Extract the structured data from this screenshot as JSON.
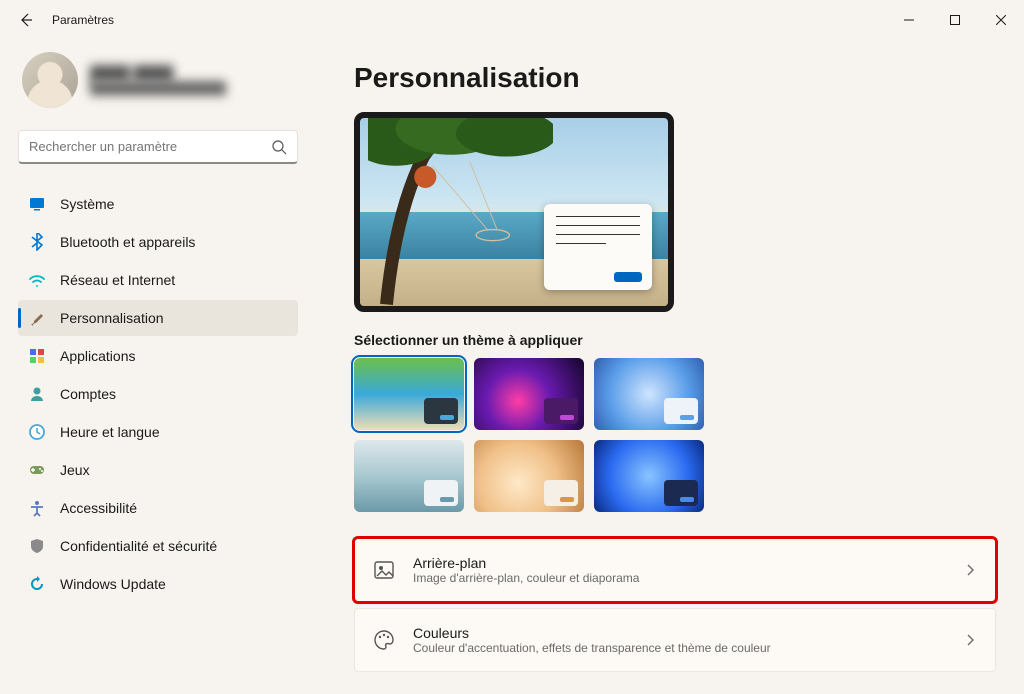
{
  "window": {
    "title": "Paramètres"
  },
  "profile": {
    "name": "████ ████",
    "email": "████████████████"
  },
  "search": {
    "placeholder": "Rechercher un paramètre"
  },
  "nav": {
    "items": [
      {
        "label": "Système",
        "icon": "system",
        "color": "#0078d4"
      },
      {
        "label": "Bluetooth et appareils",
        "icon": "bluetooth",
        "color": "#0078d4"
      },
      {
        "label": "Réseau et Internet",
        "icon": "wifi",
        "color": "#00b7c3"
      },
      {
        "label": "Personnalisation",
        "icon": "brush",
        "color": "#8a6b4f",
        "selected": true
      },
      {
        "label": "Applications",
        "icon": "apps",
        "color": "#4f6bed"
      },
      {
        "label": "Comptes",
        "icon": "person",
        "color": "#3aa0a0"
      },
      {
        "label": "Heure et langue",
        "icon": "clock",
        "color": "#4aa8d8"
      },
      {
        "label": "Jeux",
        "icon": "game",
        "color": "#7a9a5a"
      },
      {
        "label": "Accessibilité",
        "icon": "access",
        "color": "#5a7ac0"
      },
      {
        "label": "Confidentialité et sécurité",
        "icon": "shield",
        "color": "#8a8a8a"
      },
      {
        "label": "Windows Update",
        "icon": "update",
        "color": "#0099bc"
      }
    ]
  },
  "page": {
    "title": "Personnalisation",
    "theme_section_label": "Sélectionner un thème à appliquer",
    "themes": [
      {
        "bg": "linear-gradient(180deg,#6cc04a 0%,#3aa8d8 50%,#eeddb8 100%)",
        "mini_bg": "#2a3740",
        "mini_btn": "#4aa8d8",
        "selected": true
      },
      {
        "bg": "radial-gradient(circle at 40% 60%,#ff3da6 0%,#6a1ab0 40%,#14052a 100%)",
        "mini_bg": "#4a1a66",
        "mini_btn": "#c04ad8"
      },
      {
        "bg": "radial-gradient(circle at 50% 50%,#cfe4ff 0%,#5a9de8 60%,#3060b0 100%)",
        "mini_bg": "#eef3fa",
        "mini_btn": "#5a9de8"
      },
      {
        "bg": "linear-gradient(180deg,#dde8ec 0%,#a8c8d0 50%,#6a9aa8 100%)",
        "mini_bg": "#f0f3f5",
        "mini_btn": "#6a9aa8"
      },
      {
        "bg": "radial-gradient(circle at 40% 60%,#ffe9c8 0%,#f0c088 50%,#b87838 100%)",
        "mini_bg": "#f5efe6",
        "mini_btn": "#d89848"
      },
      {
        "bg": "radial-gradient(circle at 50% 50%,#88c4ff 0%,#2a6af0 60%,#0a2a80 100%)",
        "mini_bg": "#1a2a50",
        "mini_btn": "#4a8af0"
      }
    ],
    "settings": [
      {
        "title": "Arrière-plan",
        "desc": "Image d'arrière-plan, couleur et diaporama",
        "icon": "picture",
        "highlight": true
      },
      {
        "title": "Couleurs",
        "desc": "Couleur d'accentuation, effets de transparence et thème de couleur",
        "icon": "palette"
      }
    ]
  }
}
